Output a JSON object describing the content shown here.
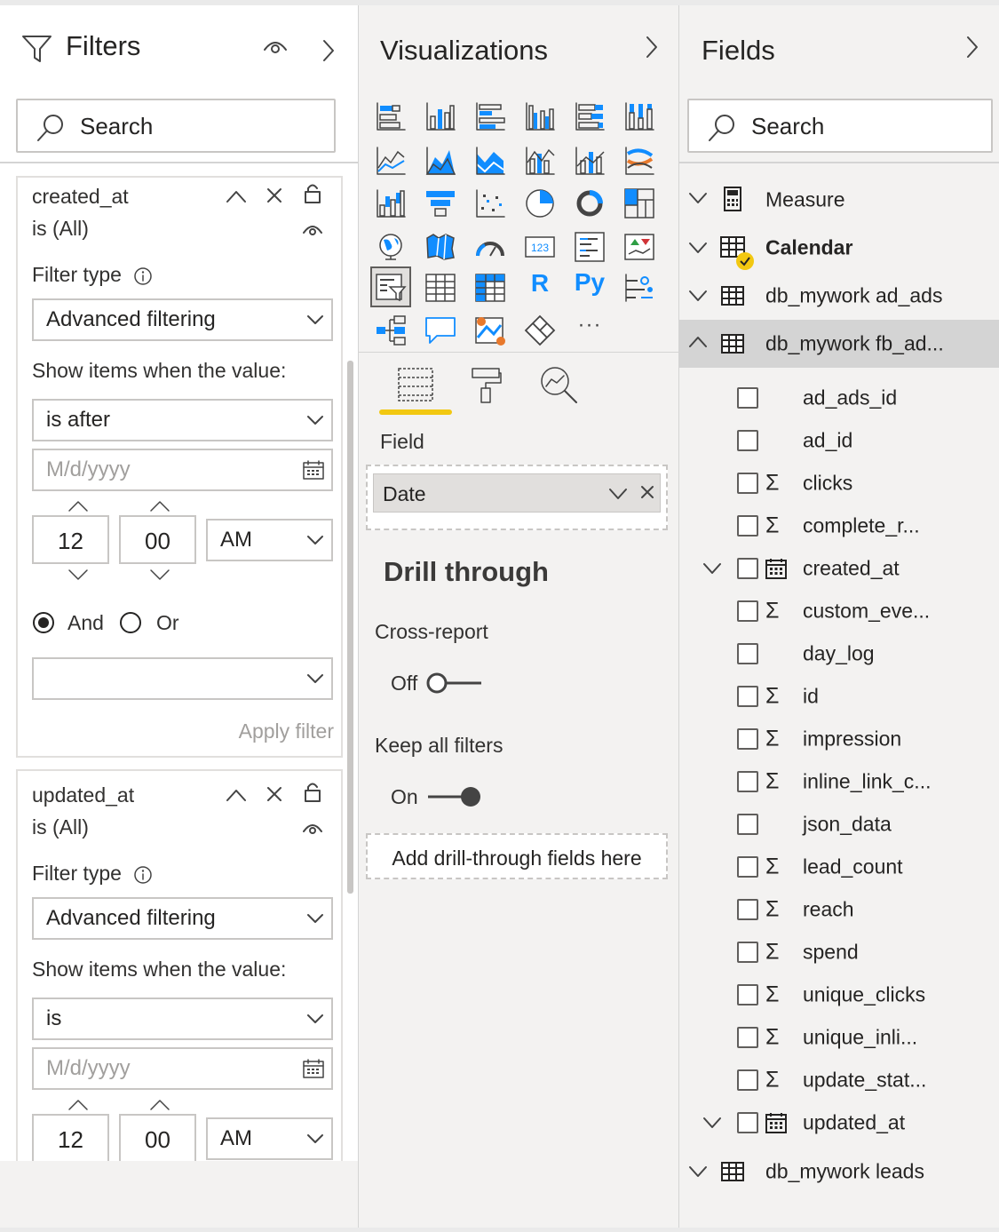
{
  "filters": {
    "title": "Filters",
    "search_placeholder": "Search",
    "cards": [
      {
        "field": "created_at",
        "status": "is (All)",
        "filter_type_label": "Filter type",
        "filter_type_value": "Advanced filtering",
        "show_items_label": "Show items when the value:",
        "condition": "is after",
        "date_placeholder": "M/d/yyyy",
        "hour": "12",
        "minute": "00",
        "ampm": "AM",
        "and_label": "And",
        "or_label": "Or",
        "and_selected": true,
        "second_condition": "",
        "apply_label": "Apply filter"
      },
      {
        "field": "updated_at",
        "status": "is (All)",
        "filter_type_label": "Filter type",
        "filter_type_value": "Advanced filtering",
        "show_items_label": "Show items when the value:",
        "condition": "is",
        "date_placeholder": "M/d/yyyy",
        "hour": "12",
        "minute": "00",
        "ampm": "AM"
      }
    ]
  },
  "visualizations": {
    "title": "Visualizations",
    "text_icons": {
      "r": "R",
      "py": "Py",
      "kpi": "123",
      "more": "···"
    },
    "field_section_label": "Field",
    "field_well_value": "Date",
    "drill_through": {
      "title": "Drill through",
      "cross_report_label": "Cross-report",
      "cross_report_state": "Off",
      "keep_filters_label": "Keep all filters",
      "keep_filters_state": "On",
      "add_fields_label": "Add drill-through fields here"
    },
    "colors": {
      "accent": "#f2c811",
      "icon_blue": "#118dff"
    }
  },
  "fields": {
    "title": "Fields",
    "search_placeholder": "Search",
    "tables": {
      "measure": "Measure",
      "calendar": "Calendar",
      "ad_ads": "db_mywork ad_ads",
      "fb_ads": "db_mywork fb_ad...",
      "leads": "db_mywork leads"
    },
    "fb_fields": [
      {
        "name": "ad_ads_id",
        "sigma": false
      },
      {
        "name": "ad_id",
        "sigma": false
      },
      {
        "name": "clicks",
        "sigma": true
      },
      {
        "name": "complete_r...",
        "sigma": true
      },
      {
        "name": "created_at",
        "date": true
      },
      {
        "name": "custom_eve...",
        "sigma": true
      },
      {
        "name": "day_log",
        "sigma": false
      },
      {
        "name": "id",
        "sigma": true
      },
      {
        "name": "impression",
        "sigma": true
      },
      {
        "name": "inline_link_c...",
        "sigma": true
      },
      {
        "name": "json_data",
        "sigma": false
      },
      {
        "name": "lead_count",
        "sigma": true
      },
      {
        "name": "reach",
        "sigma": true
      },
      {
        "name": "spend",
        "sigma": true
      },
      {
        "name": "unique_clicks",
        "sigma": true
      },
      {
        "name": "unique_inli...",
        "sigma": true
      },
      {
        "name": "update_stat...",
        "sigma": true
      },
      {
        "name": "updated_at",
        "date": true
      }
    ],
    "sigma_symbol": "Σ"
  }
}
